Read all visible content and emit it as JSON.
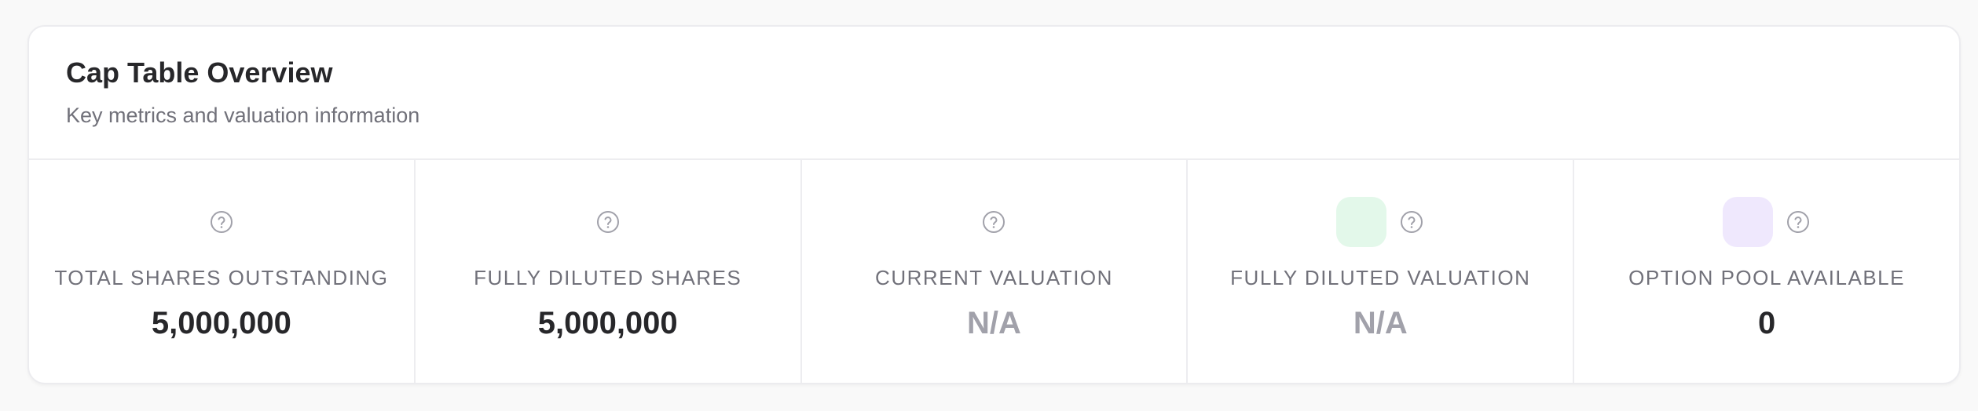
{
  "card": {
    "title": "Cap Table Overview",
    "subtitle": "Key metrics and valuation information"
  },
  "metrics": [
    {
      "label": "TOTAL SHARES OUTSTANDING",
      "value": "5,000,000",
      "value_state": "normal",
      "icon": "help-circle-icon",
      "tile_color": null
    },
    {
      "label": "FULLY DILUTED SHARES",
      "value": "5,000,000",
      "value_state": "normal",
      "icon": "help-circle-icon",
      "tile_color": null
    },
    {
      "label": "CURRENT VALUATION",
      "value": "N/A",
      "value_state": "muted",
      "icon": "help-circle-icon",
      "tile_color": null
    },
    {
      "label": "FULLY DILUTED VALUATION",
      "value": "N/A",
      "value_state": "muted",
      "icon": "help-circle-icon",
      "tile_color": "#e3f8ea"
    },
    {
      "label": "OPTION POOL AVAILABLE",
      "value": "0",
      "value_state": "normal",
      "icon": "help-circle-icon",
      "tile_color": "#efe8fd"
    }
  ],
  "colors": {
    "text_primary": "#27272a",
    "text_secondary": "#71717a",
    "text_muted": "#a1a1aa",
    "border": "#ececef",
    "icon_stroke": "#a1a1aa"
  }
}
